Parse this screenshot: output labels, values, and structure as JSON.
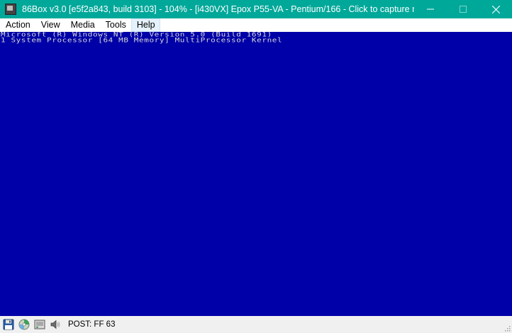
{
  "window": {
    "title": "86Box v3.0 [e5f2a843, build 3103] - 104% - [i430VX] Epox P55-VA - Pentium/166 - Click to capture mouse...",
    "accent_color": "#00a89a",
    "controls": {
      "minimize_icon": "minimize-icon",
      "maximize_icon": "maximize-icon",
      "close_icon": "close-icon"
    }
  },
  "menu": {
    "items": [
      {
        "label": "Action"
      },
      {
        "label": "View"
      },
      {
        "label": "Media"
      },
      {
        "label": "Tools"
      },
      {
        "label": "Help",
        "highlighted": true
      }
    ]
  },
  "screen": {
    "background": "#0000a8",
    "text_color": "#d8d8d8",
    "lines": [
      "Microsoft (R) Windows NT (R) Version 5.0 (Build 1691)",
      "1 System Processor [64 MB Memory] MultiProcessor Kernel"
    ]
  },
  "statusbar": {
    "icons": [
      "floppy-disk-icon",
      "cdrom-icon",
      "hard-disk-icon",
      "sound-icon"
    ],
    "post_text": "POST: FF 63"
  }
}
